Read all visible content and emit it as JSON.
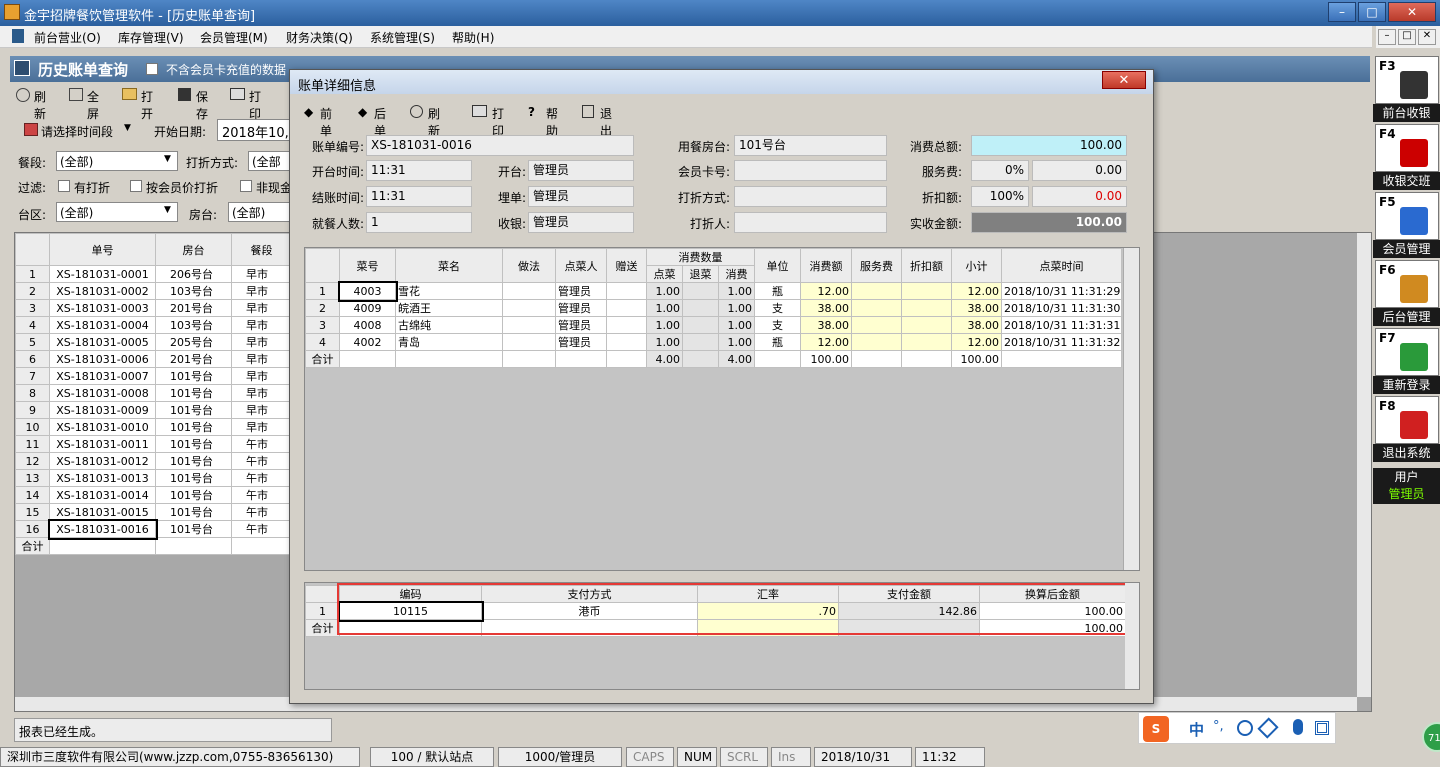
{
  "app": {
    "title": "金宇招牌餐饮管理软件 - [历史账单查询]",
    "window_controls": [
      "–",
      "□",
      "✕"
    ],
    "child_controls": [
      "–",
      "□",
      "✕"
    ]
  },
  "menu": [
    "前台营业(O)",
    "库存管理(V)",
    "会员管理(M)",
    "财务决策(Q)",
    "系统管理(S)",
    "帮助(H)"
  ],
  "page": {
    "title": "历史账单查询",
    "exclude_label": "不含会员卡充值的数据"
  },
  "toolbar": {
    "refresh": "刷新",
    "fullscreen": "全屏",
    "open": "打开",
    "save": "保存",
    "print": "打印"
  },
  "filters": {
    "period_label": "请选择时间段",
    "start_label": "开始日期:",
    "start_value": "2018年10,",
    "meal_label": "餐段:",
    "meal_value": "(全部)",
    "discount_label": "打折方式:",
    "discount_value": "(全部",
    "filter_label": "过滤:",
    "opt_printed": "有打折",
    "opt_member": "按会员价打折",
    "opt_noncash": "非现金",
    "area_label": "台区:",
    "area_value": "(全部)",
    "room_label": "房台:",
    "room_value": "(全部)"
  },
  "list": {
    "headers": [
      "单号",
      "房台",
      "餐段"
    ],
    "rows": [
      [
        "XS-181031-0001",
        "206号台",
        "早市"
      ],
      [
        "XS-181031-0002",
        "103号台",
        "早市"
      ],
      [
        "XS-181031-0003",
        "201号台",
        "早市"
      ],
      [
        "XS-181031-0004",
        "103号台",
        "早市"
      ],
      [
        "XS-181031-0005",
        "205号台",
        "早市"
      ],
      [
        "XS-181031-0006",
        "201号台",
        "早市"
      ],
      [
        "XS-181031-0007",
        "101号台",
        "早市"
      ],
      [
        "XS-181031-0008",
        "101号台",
        "早市"
      ],
      [
        "XS-181031-0009",
        "101号台",
        "早市"
      ],
      [
        "XS-181031-0010",
        "101号台",
        "早市"
      ],
      [
        "XS-181031-0011",
        "101号台",
        "午市"
      ],
      [
        "XS-181031-0012",
        "101号台",
        "午市"
      ],
      [
        "XS-181031-0013",
        "101号台",
        "午市"
      ],
      [
        "XS-181031-0014",
        "101号台",
        "午市"
      ],
      [
        "XS-181031-0015",
        "101号台",
        "午市"
      ],
      [
        "XS-181031-0016",
        "101号台",
        "午市"
      ]
    ],
    "total_label": "合计"
  },
  "status_msg": "报表已经生成。",
  "dialog": {
    "title": "账单详细信息",
    "close": "✕",
    "tb": {
      "prev": "前单",
      "next": "后单",
      "refresh": "刷新",
      "print": "打印",
      "help": "帮助",
      "exit": "退出"
    },
    "info": {
      "bill_no_label": "账单编号:",
      "bill_no": "XS-181031-0016",
      "open_time_label": "开台时间:",
      "open_time": "11:31",
      "settle_time_label": "结账时间:",
      "settle_time": "11:31",
      "guests_label": "就餐人数:",
      "guests": "1",
      "opener_label": "开台:",
      "opener": "管理员",
      "payer_label": "埋单:",
      "payer": "管理员",
      "cashier_label": "收银:",
      "cashier": "管理员",
      "room_label": "用餐房台:",
      "room": "101号台",
      "card_label": "会员卡号:",
      "card": "",
      "discount_mode_label": "打折方式:",
      "discount_mode": "",
      "discounter_label": "打折人:",
      "discounter": "",
      "total_label": "消费总额:",
      "total": "100.00",
      "service_label": "服务费:",
      "service_pct": "0%",
      "service": "0.00",
      "discount_label": "折扣额:",
      "discount_pct": "100%",
      "discount": "0.00",
      "actual_label": "实收金额:",
      "actual": "100.00"
    },
    "items": {
      "headers": {
        "code": "菜号",
        "name": "菜名",
        "method": "做法",
        "waiter": "点菜人",
        "gift": "赠送",
        "qty_group": "消费数量",
        "qty_order": "点菜",
        "qty_return": "退菜",
        "qty_use": "消费",
        "unit": "单位",
        "amount": "消费额",
        "service": "服务费",
        "discount": "折扣额",
        "subtotal": "小计",
        "time": "点菜时间"
      },
      "rows": [
        [
          "1",
          "4003",
          "雪花",
          "",
          "管理员",
          "",
          "1.00",
          "",
          "1.00",
          "瓶",
          "12.00",
          "",
          "",
          "12.00",
          "2018/10/31 11:31:29"
        ],
        [
          "2",
          "4009",
          "皖酒王",
          "",
          "管理员",
          "",
          "1.00",
          "",
          "1.00",
          "支",
          "38.00",
          "",
          "",
          "38.00",
          "2018/10/31 11:31:30"
        ],
        [
          "3",
          "4008",
          "古绵纯",
          "",
          "管理员",
          "",
          "1.00",
          "",
          "1.00",
          "支",
          "38.00",
          "",
          "",
          "38.00",
          "2018/10/31 11:31:31"
        ],
        [
          "4",
          "4002",
          "青岛",
          "",
          "管理员",
          "",
          "1.00",
          "",
          "1.00",
          "瓶",
          "12.00",
          "",
          "",
          "12.00",
          "2018/10/31 11:31:32"
        ]
      ],
      "total": [
        "合计",
        "",
        "",
        "",
        "",
        "",
        "4.00",
        "",
        "4.00",
        "",
        "100.00",
        "",
        "",
        "100.00",
        ""
      ]
    },
    "payments": {
      "headers": [
        "编码",
        "支付方式",
        "汇率",
        "支付金额",
        "换算后金额"
      ],
      "rows": [
        [
          "1",
          "10115",
          "港币",
          ".70",
          "142.86",
          "100.00"
        ]
      ],
      "total": [
        "合计",
        "",
        "",
        "",
        "",
        "100.00"
      ]
    }
  },
  "sidebar": [
    {
      "key": "F3",
      "label": "前台收银"
    },
    {
      "key": "F4",
      "label": "收银交班"
    },
    {
      "key": "F5",
      "label": "会员管理"
    },
    {
      "key": "F6",
      "label": "后台管理"
    },
    {
      "key": "F7",
      "label": "重新登录"
    },
    {
      "key": "F8",
      "label": "退出系统"
    }
  ],
  "user": {
    "label": "用户",
    "name": "管理员"
  },
  "ime": [
    "中",
    "°,"
  ],
  "statusbar": {
    "company": "深圳市三度软件有限公司(www.jzzp.com,0755-83656130)",
    "station": "100 / 默认站点",
    "operator": "1000/管理员",
    "caps": "CAPS",
    "num": "NUM",
    "scrl": "SCRL",
    "ins": "Ins",
    "date": "2018/10/31",
    "time": "11:32"
  },
  "badge": "71"
}
